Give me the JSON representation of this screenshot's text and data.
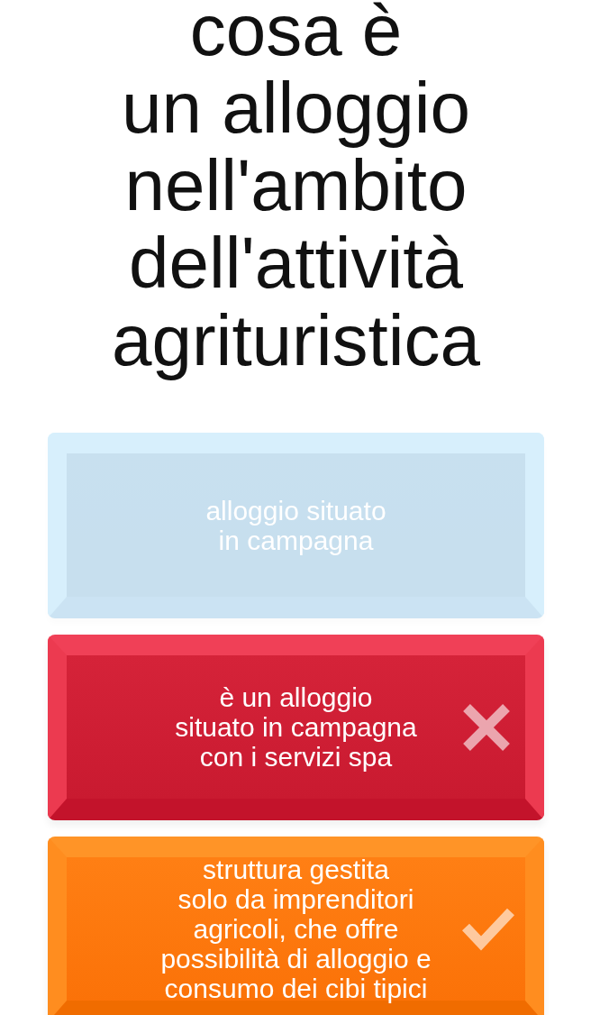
{
  "question": {
    "text": "cosa è\nun alloggio\nnell'ambito\ndell'attività\nagrituristica"
  },
  "answers": [
    {
      "text": "alloggio situato\nin campagna",
      "kind": "neutral",
      "disabled": true
    },
    {
      "text": "è un alloggio\nsituato in campagna\ncon i servizi spa",
      "kind": "wrong",
      "disabled": false
    },
    {
      "text": "struttura gestita\nsolo da imprenditori\nagricoli, che offre\npossibilità di alloggio e\nconsumo dei cibi tipici",
      "kind": "correct",
      "disabled": false
    }
  ]
}
